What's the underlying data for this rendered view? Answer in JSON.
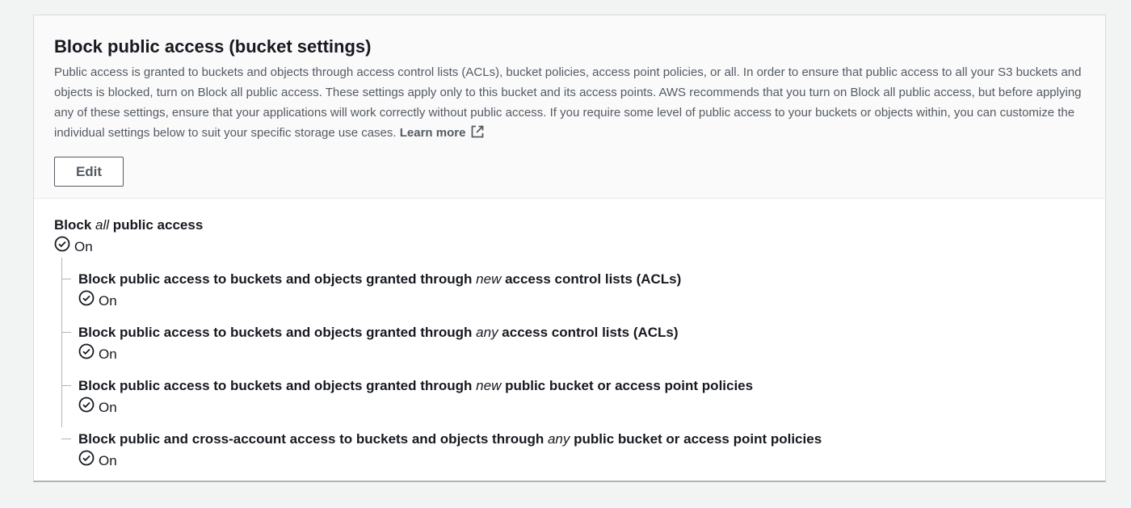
{
  "header": {
    "title": "Block public access (bucket settings)",
    "description": "Public access is granted to buckets and objects through access control lists (ACLs), bucket policies, access point policies, or all. In order to ensure that public access to all your S3 buckets and objects is blocked, turn on Block all public access. These settings apply only to this bucket and its access points. AWS recommends that you turn on Block all public access, but before applying any of these settings, ensure that your applications will work correctly without public access. If you require some level of public access to your buckets or objects within, you can customize the individual settings below to suit your specific storage use cases.",
    "learn_more": "Learn more",
    "edit_label": "Edit"
  },
  "master": {
    "label_before": "Block ",
    "label_emphasis": "all",
    "label_after": " public access",
    "status": "On"
  },
  "settings": [
    {
      "before": "Block public access to buckets and objects granted through ",
      "emphasis": "new",
      "after": " access control lists (ACLs)",
      "status": "On"
    },
    {
      "before": "Block public access to buckets and objects granted through ",
      "emphasis": "any",
      "after": " access control lists (ACLs)",
      "status": "On"
    },
    {
      "before": "Block public access to buckets and objects granted through ",
      "emphasis": "new",
      "after": " public bucket or access point policies",
      "status": "On"
    },
    {
      "before": "Block public and cross-account access to buckets and objects through ",
      "emphasis": "any",
      "after": " public bucket or access point policies",
      "status": "On"
    }
  ]
}
